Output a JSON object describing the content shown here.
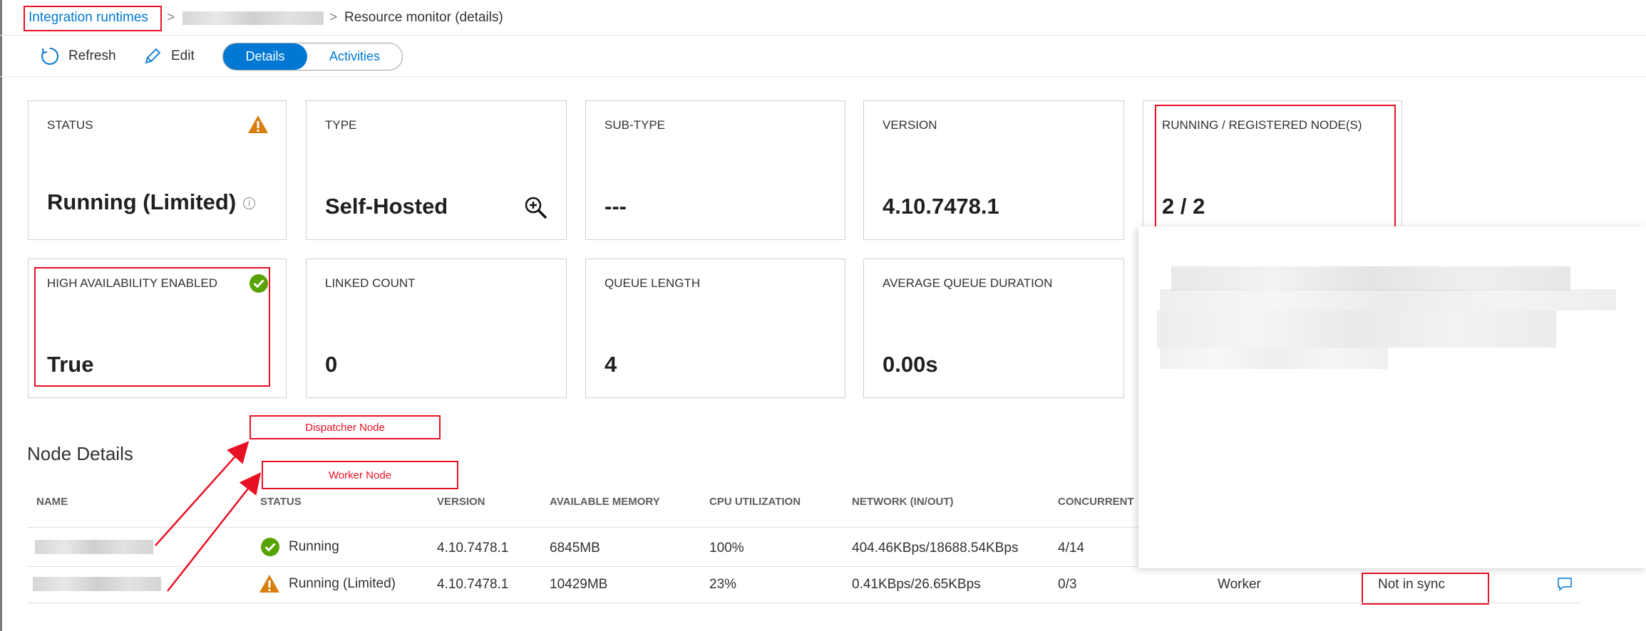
{
  "breadcrumb": {
    "root": "Integration runtimes",
    "sep1": ">",
    "sep2": ">",
    "current": "Resource monitor (details)"
  },
  "toolbar": {
    "refresh_label": "Refresh",
    "edit_label": "Edit",
    "tabs": [
      {
        "label": "Details",
        "selected": true
      },
      {
        "label": "Activities",
        "selected": false
      }
    ]
  },
  "cards": {
    "status": {
      "label": "STATUS",
      "value": "Running (Limited)",
      "info": "i"
    },
    "type": {
      "label": "TYPE",
      "value": "Self-Hosted"
    },
    "subtype": {
      "label": "SUB-TYPE",
      "value": "---"
    },
    "version": {
      "label": "VERSION",
      "value": "4.10.7478.1"
    },
    "nodes": {
      "label": "RUNNING / REGISTERED NODE(S)",
      "value": "2 / 2"
    },
    "ha": {
      "label": "HIGH AVAILABILITY ENABLED",
      "value": "True"
    },
    "linked": {
      "label": "LINKED COUNT",
      "value": "0"
    },
    "queue": {
      "label": "QUEUE LENGTH",
      "value": "4"
    },
    "avgqueue": {
      "label": "AVERAGE QUEUE DURATION",
      "value": "0.00s"
    }
  },
  "annotations": {
    "dispatcher": "Dispatcher Node",
    "worker": "Worker Node"
  },
  "node_details": {
    "title": "Node Details",
    "columns": [
      "NAME",
      "STATUS",
      "VERSION",
      "AVAILABLE MEMORY",
      "CPU UTILIZATION",
      "NETWORK (IN/OUT)",
      "CONCURRENT"
    ],
    "rows": [
      {
        "status": "Running",
        "status_icon": "check-circle-icon",
        "version": "4.10.7478.1",
        "memory": "6845MB",
        "cpu": "100%",
        "network": "404.46KBps/18688.54KBps",
        "concurrent": "4/14",
        "role": "",
        "sync": ""
      },
      {
        "status": "Running (Limited)",
        "status_icon": "warning-icon",
        "version": "4.10.7478.1",
        "memory": "10429MB",
        "cpu": "23%",
        "network": "0.41KBps/26.65KBps",
        "concurrent": "0/3",
        "role": "Worker",
        "sync": "Not in sync"
      }
    ]
  },
  "colors": {
    "accent": "#0078d4",
    "warning": "#d87e0e",
    "success": "#57a300",
    "annotation": "#e81123"
  }
}
